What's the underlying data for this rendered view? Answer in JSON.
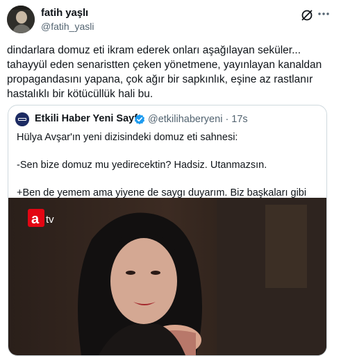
{
  "author": {
    "name": "fatih yaşlı",
    "handle": "@fatih_yasli",
    "text": "dindarlara domuz eti ikram ederek onları aşağılayan seküler...\ntahayyül eden senaristten çeken yönetmene, yayınlayan kanaldan propagandasını yapana, çok ağır bir sapkınlık, eşine az rastlanır hastalıklı bir kötücüllük hali bu."
  },
  "header_icons": {
    "grok": "grok-icon",
    "more": "more-icon"
  },
  "quote": {
    "name": "Etkili Haber Yeni Sayfa",
    "handle_time": "@etkilihaberyeni · 17s",
    "text": "Hülya Avşar'ın yeni dizisindeki domuz eti sahnesi:\n\n-Sen bize domuz mu yedirecektin? Hadsiz. Utanmazsın.\n\n+Ben de yemem ama yiyene de saygı duyarım. Biz başkaları gibi hoşgörüsüz ...",
    "verified_icon": "verified-badge-icon",
    "media": {
      "logo": "a tv"
    }
  },
  "colors": {
    "text": "#0f1419",
    "secondary": "#536471",
    "border": "#cfd9de",
    "verified": "#1d9bf0",
    "logo": "#e30613"
  }
}
